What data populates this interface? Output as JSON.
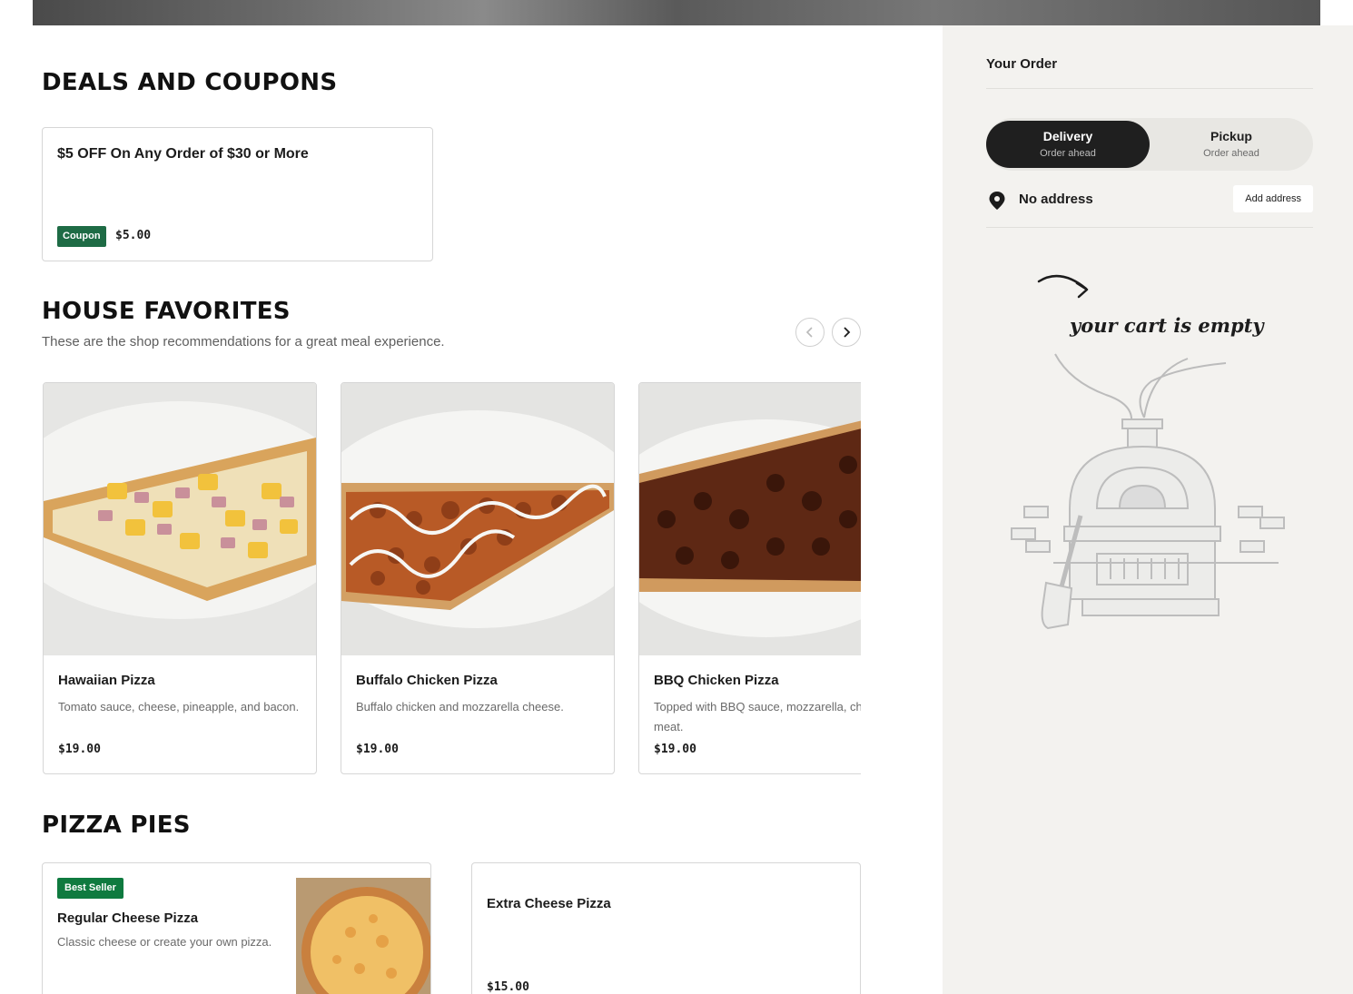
{
  "deals": {
    "title": "DEALS AND COUPONS",
    "coupon": {
      "title": "$5 OFF On Any Order of $30 or More",
      "badge": "Coupon",
      "amount": "$5.00"
    }
  },
  "favorites": {
    "title": "HOUSE FAVORITES",
    "subtitle": "These are the shop recommendations for a great meal experience.",
    "prev_icon": "chevron-left-icon",
    "next_icon": "chevron-right-icon",
    "items": [
      {
        "name": "Hawaiian Pizza",
        "description": "Tomato sauce, cheese, pineapple, and bacon.",
        "price": "$19.00"
      },
      {
        "name": "Buffalo Chicken Pizza",
        "description": "Buffalo chicken and mozzarella cheese.",
        "price": "$19.00"
      },
      {
        "name": "BBQ Chicken Pizza",
        "description": "Topped with BBQ sauce, mozzarella, chicken meat.",
        "price": "$19.00"
      }
    ]
  },
  "pies": {
    "title": "PIZZA PIES",
    "items": [
      {
        "badge": "Best Seller",
        "name": "Regular Cheese Pizza",
        "description": "Classic cheese or create your own pizza."
      },
      {
        "name": "Extra Cheese Pizza",
        "price": "$15.00"
      }
    ]
  },
  "order": {
    "title": "Your Order",
    "modes": [
      {
        "label": "Delivery",
        "sub": "Order ahead",
        "active": true
      },
      {
        "label": "Pickup",
        "sub": "Order ahead",
        "active": false
      }
    ],
    "address": "No address",
    "add_address_label": "Add address",
    "empty_cart_text": "your cart is empty"
  },
  "colors": {
    "coupon_badge": "#1e6b45",
    "best_seller_badge": "#0f7a3f",
    "active_toggle": "#1f1f1f",
    "sidebar_bg": "#f3f2ef"
  }
}
